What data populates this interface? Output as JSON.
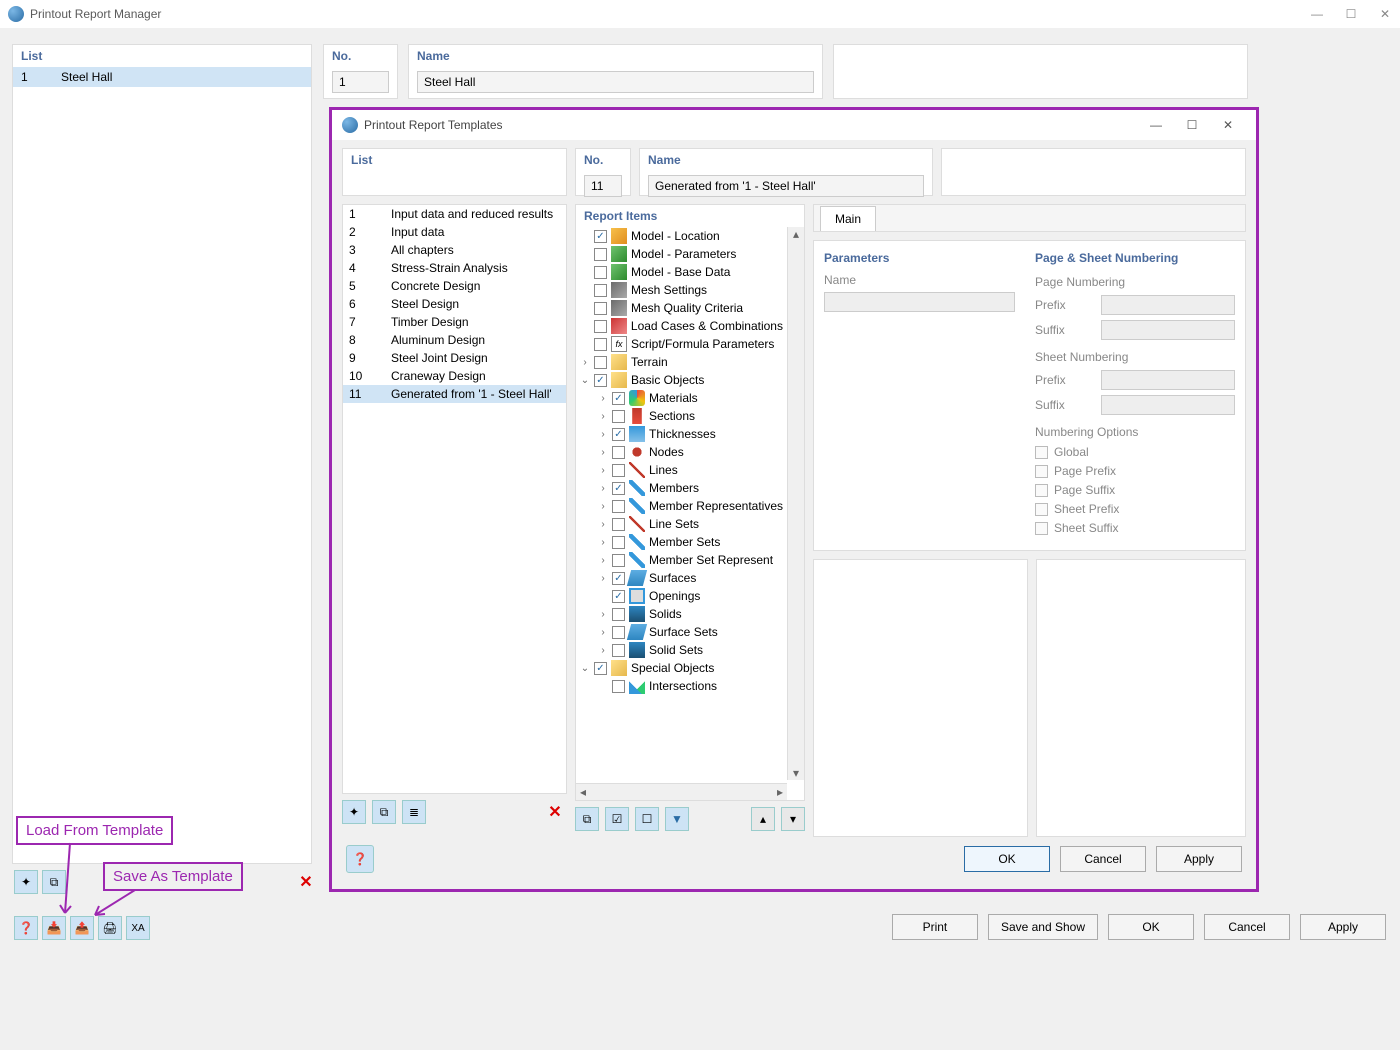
{
  "outerWindow": {
    "title": "Printout Report Manager",
    "listHeader": "List",
    "listRow": {
      "num": "1",
      "name": "Steel Hall"
    },
    "noHeader": "No.",
    "noValue": "1",
    "nameHeader": "Name",
    "nameValue": "Steel Hall",
    "buttons": {
      "print": "Print",
      "saveShow": "Save and Show",
      "ok": "OK",
      "cancel": "Cancel",
      "apply": "Apply"
    }
  },
  "modal": {
    "title": "Printout Report Templates",
    "listHeader": "List",
    "noHeader": "No.",
    "noValue": "11",
    "nameHeader": "Name",
    "nameValue": "Generated from '1 - Steel Hall'",
    "templates": [
      {
        "n": "1",
        "name": "Input data and reduced results"
      },
      {
        "n": "2",
        "name": "Input data"
      },
      {
        "n": "3",
        "name": "All chapters"
      },
      {
        "n": "4",
        "name": "Stress-Strain Analysis"
      },
      {
        "n": "5",
        "name": "Concrete Design"
      },
      {
        "n": "6",
        "name": "Steel Design"
      },
      {
        "n": "7",
        "name": "Timber Design"
      },
      {
        "n": "8",
        "name": "Aluminum Design"
      },
      {
        "n": "9",
        "name": "Steel Joint Design"
      },
      {
        "n": "10",
        "name": "Craneway Design"
      },
      {
        "n": "11",
        "name": "Generated from '1 - Steel Hall'"
      }
    ],
    "reportItemsHeader": "Report Items",
    "tree": [
      {
        "indent": 0,
        "exp": "",
        "chk": true,
        "icon": "ic-loc",
        "label": "Model - Location"
      },
      {
        "indent": 0,
        "exp": "",
        "chk": false,
        "icon": "ic-param",
        "label": "Model - Parameters"
      },
      {
        "indent": 0,
        "exp": "",
        "chk": false,
        "icon": "ic-param",
        "label": "Model - Base Data"
      },
      {
        "indent": 0,
        "exp": "",
        "chk": false,
        "icon": "ic-mesh",
        "label": "Mesh Settings"
      },
      {
        "indent": 0,
        "exp": "",
        "chk": false,
        "icon": "ic-mesh",
        "label": "Mesh Quality Criteria"
      },
      {
        "indent": 0,
        "exp": "",
        "chk": false,
        "icon": "ic-load",
        "label": "Load Cases & Combinations"
      },
      {
        "indent": 0,
        "exp": "",
        "chk": false,
        "icon": "ic-fx",
        "label": "Script/Formula Parameters"
      },
      {
        "indent": 0,
        "exp": ">",
        "chk": false,
        "icon": "ic-folder",
        "label": "Terrain"
      },
      {
        "indent": 0,
        "exp": "v",
        "chk": true,
        "icon": "ic-folder",
        "label": "Basic Objects"
      },
      {
        "indent": 1,
        "exp": ">",
        "chk": true,
        "icon": "ic-mat",
        "label": "Materials"
      },
      {
        "indent": 1,
        "exp": ">",
        "chk": false,
        "icon": "ic-sec",
        "label": "Sections"
      },
      {
        "indent": 1,
        "exp": ">",
        "chk": true,
        "icon": "ic-thk",
        "label": "Thicknesses"
      },
      {
        "indent": 1,
        "exp": ">",
        "chk": false,
        "icon": "ic-node",
        "label": "Nodes"
      },
      {
        "indent": 1,
        "exp": ">",
        "chk": false,
        "icon": "ic-line",
        "label": "Lines"
      },
      {
        "indent": 1,
        "exp": ">",
        "chk": true,
        "icon": "ic-member",
        "label": "Members"
      },
      {
        "indent": 1,
        "exp": ">",
        "chk": false,
        "icon": "ic-member",
        "label": "Member Representatives"
      },
      {
        "indent": 1,
        "exp": ">",
        "chk": false,
        "icon": "ic-line",
        "label": "Line Sets"
      },
      {
        "indent": 1,
        "exp": ">",
        "chk": false,
        "icon": "ic-member",
        "label": "Member Sets"
      },
      {
        "indent": 1,
        "exp": ">",
        "chk": false,
        "icon": "ic-member",
        "label": "Member Set Represent"
      },
      {
        "indent": 1,
        "exp": ">",
        "chk": true,
        "icon": "ic-surf",
        "label": "Surfaces"
      },
      {
        "indent": 1,
        "exp": "",
        "chk": true,
        "icon": "ic-open",
        "label": "Openings"
      },
      {
        "indent": 1,
        "exp": ">",
        "chk": false,
        "icon": "ic-solid",
        "label": "Solids"
      },
      {
        "indent": 1,
        "exp": ">",
        "chk": false,
        "icon": "ic-surf",
        "label": "Surface Sets"
      },
      {
        "indent": 1,
        "exp": ">",
        "chk": false,
        "icon": "ic-solid",
        "label": "Solid Sets"
      },
      {
        "indent": 0,
        "exp": "v",
        "chk": true,
        "icon": "ic-folder",
        "label": "Special Objects"
      },
      {
        "indent": 1,
        "exp": "",
        "chk": false,
        "icon": "ic-inter",
        "label": "Intersections"
      }
    ],
    "tab": "Main",
    "paramsHeader": "Parameters",
    "paramName": "Name",
    "sheetHeader": "Page & Sheet Numbering",
    "pageNumbering": "Page Numbering",
    "prefix": "Prefix",
    "suffix": "Suffix",
    "sheetNumbering": "Sheet Numbering",
    "numberingOptions": "Numbering Options",
    "optGlobal": "Global",
    "optPagePrefix": "Page Prefix",
    "optPageSuffix": "Page Suffix",
    "optSheetPrefix": "Sheet Prefix",
    "optSheetSuffix": "Sheet Suffix",
    "buttons": {
      "ok": "OK",
      "cancel": "Cancel",
      "apply": "Apply"
    }
  },
  "callouts": {
    "loadFrom": "Load From Template",
    "saveAs": "Save As Template"
  }
}
